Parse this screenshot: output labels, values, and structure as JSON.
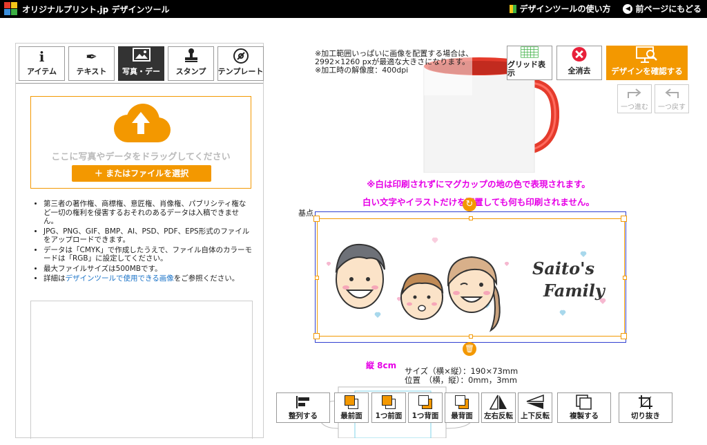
{
  "header": {
    "logo_text": "オリジナルプリント.jp デザインツール",
    "guide_link": "デザインツールの使い方",
    "back_link": "前ページにもどる"
  },
  "tabs": [
    {
      "label": "アイテム",
      "icon": "info-icon"
    },
    {
      "label": "テキスト",
      "icon": "pen-icon"
    },
    {
      "label": "写真・デー",
      "icon": "photo-icon"
    },
    {
      "label": "スタンプ",
      "icon": "stamp-icon"
    },
    {
      "label": "テンプレート",
      "icon": "template-icon"
    }
  ],
  "upload": {
    "drop_text": "ここに写真やデータをドラッグしてください",
    "file_button": "＋ またはファイルを選択"
  },
  "notes": {
    "n1": "第三者の著作権、商標権、意匠権、肖像権、パブリシティ権など一切の権利を侵害するおそれのあるデータは入稿できません。",
    "n2": "JPG、PNG、GIF、BMP、AI、PSD、PDF、EPS形式のファイルをアップロードできます。",
    "n3": "データは「CMYK」で作成したうえで、ファイル自体のカラーモードは「RGB」に設定してください。",
    "n4": "最大ファイルサイズは500MBです。",
    "n5_pre": "詳細は",
    "n5_link": "デザインツールで使用できる画像",
    "n5_post": "をご参照ください。"
  },
  "hint": {
    "line1": "※加工範囲いっぱいに画像を配置する場合は、",
    "line2": "2992×1260 pxが最適な大きさになります。",
    "line3": "※加工時の解像度：400dpi"
  },
  "top_buttons": {
    "grid": "グリッド表示",
    "clear": "全消去",
    "confirm": "デザインを確認する",
    "redo": "一つ進む",
    "undo": "一つ戻す"
  },
  "warnings": {
    "line1": "※白は印刷されずにマグカップの地の色で表現されます。",
    "line2": "白い文字やイラストだけを配置しても何も印刷されません。"
  },
  "canvas": {
    "base_point": "基点",
    "artwork_text_1": "Saito's",
    "artwork_text_2": "Family"
  },
  "size": {
    "height_label": "縦 8cm",
    "info": "サイズ（横×縦）：190×73mm\n位置　（横，縦）：0mm，3mm"
  },
  "toolbar": [
    {
      "label": "整列する",
      "icon": "align-icon"
    },
    {
      "label": "最前面",
      "icon": "bring-front-icon"
    },
    {
      "label": "1つ前面",
      "icon": "bring-forward-icon"
    },
    {
      "label": "1つ背面",
      "icon": "send-backward-icon"
    },
    {
      "label": "最背面",
      "icon": "send-back-icon"
    },
    {
      "label": "左右反転",
      "icon": "flip-horizontal-icon"
    },
    {
      "label": "上下反転",
      "icon": "flip-vertical-icon"
    },
    {
      "label": "複製する",
      "icon": "duplicate-icon"
    },
    {
      "label": "切り抜き",
      "icon": "crop-icon"
    }
  ],
  "colors": {
    "accent": "#f39800",
    "warning": "#e600e6",
    "mug_handle": "#e53b2c",
    "link": "#1a73c8"
  }
}
